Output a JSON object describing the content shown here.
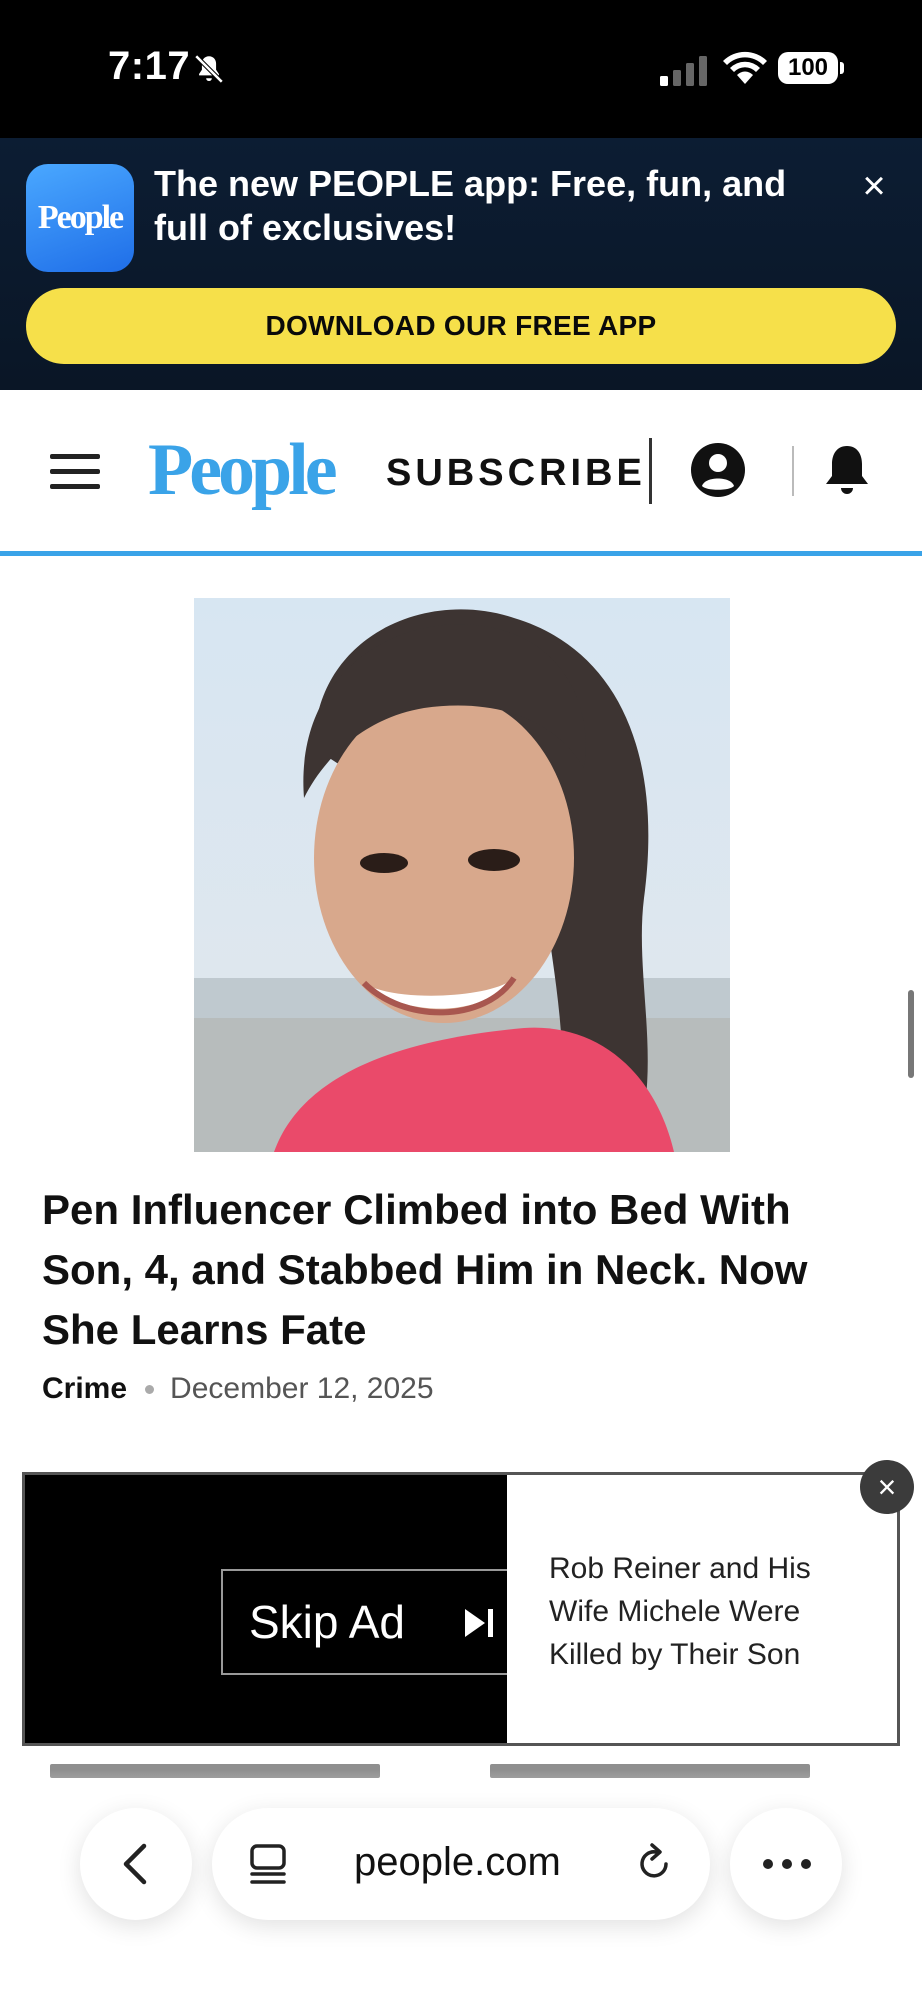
{
  "status_bar": {
    "time": "7:17",
    "battery": "100",
    "icons": [
      "bell-slash-icon",
      "cellular-signal-icon",
      "wifi-icon",
      "battery-icon"
    ]
  },
  "app_banner": {
    "icon_text": "People",
    "message": "The new PEOPLE app: Free, fun, and full of exclusives!",
    "close_label": "×",
    "cta_label": "DOWNLOAD OUR FREE APP",
    "cta_color": "#f6e04a",
    "background": "#0c1d33"
  },
  "header": {
    "logo_text": "People",
    "subscribe_label": "SUBSCRIBE",
    "brand_color": "#3aa3e8",
    "icons": [
      "hamburger-menu-icon",
      "account-icon",
      "bell-icon"
    ]
  },
  "article": {
    "headline": "Pen Influencer Climbed into Bed With Son, 4, and Stabbed Him in Neck. Now She Learns Fate",
    "category": "Crime",
    "date": "December 12, 2025"
  },
  "video_ad": {
    "skip_label": "Skip Ad",
    "title": "Rob Reiner and His Wife Michele Were Killed by Their Son",
    "close_label": "×"
  },
  "browser": {
    "url": "people.com",
    "icons": [
      "back-chevron-icon",
      "tabs-icon",
      "reload-icon",
      "more-icon"
    ]
  }
}
